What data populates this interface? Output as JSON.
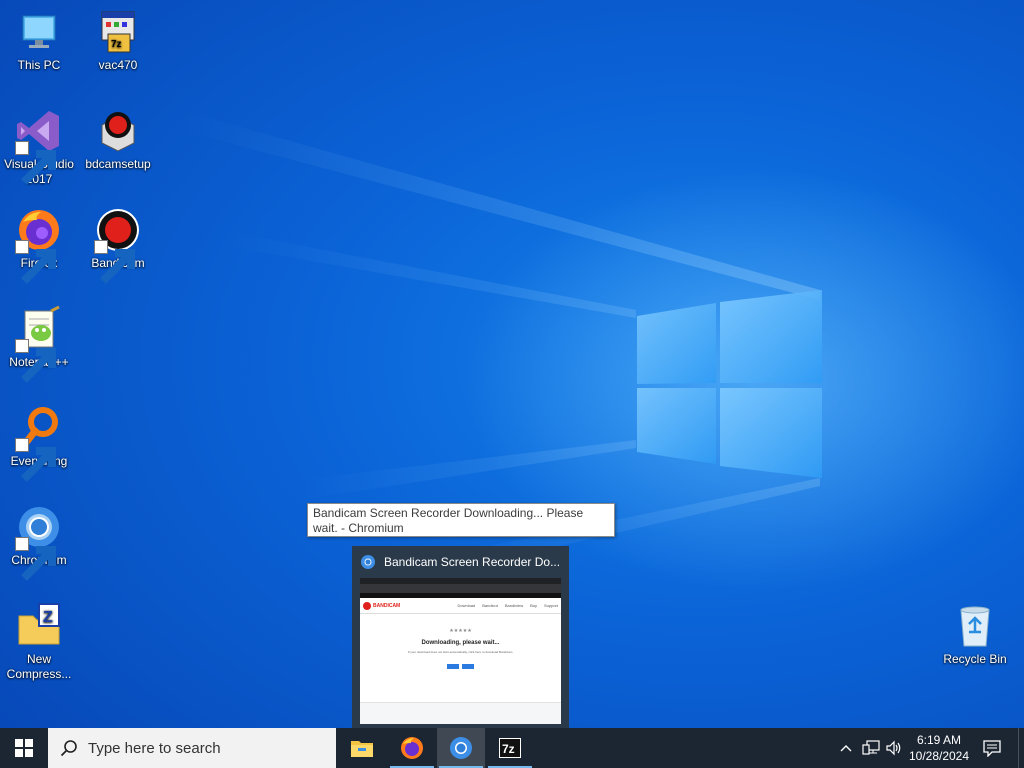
{
  "desktop": {
    "icons": [
      {
        "label": "This PC",
        "icon": "monitor-icon"
      },
      {
        "label": "vac470",
        "icon": "installer-icon"
      },
      {
        "label": "Visual Studio 2017",
        "icon": "visual-studio-icon"
      },
      {
        "label": "bdcamsetup",
        "icon": "bandicam-setup-icon"
      },
      {
        "label": "Firefox",
        "icon": "firefox-icon"
      },
      {
        "label": "Bandicam",
        "icon": "bandicam-icon"
      },
      {
        "label": "Notepad++",
        "icon": "notepadpp-icon"
      },
      {
        "label": "Everything",
        "icon": "everything-icon"
      },
      {
        "label": "Chromium",
        "icon": "chromium-icon"
      },
      {
        "label": "New Compress...",
        "icon": "zip-folder-icon"
      },
      {
        "label": "Recycle Bin",
        "icon": "recycle-bin-icon"
      }
    ]
  },
  "tooltip": {
    "text": "Bandicam Screen Recorder Downloading... Please wait. - Chromium"
  },
  "thumbnail": {
    "title": "Bandicam Screen Recorder Do...",
    "preview": {
      "brand": "BANDICAM",
      "nav": [
        "Download",
        "Bandicut",
        "Bandiview",
        "Buy",
        "Support"
      ],
      "heading": "Downloading, please wait...",
      "line": "If your download does not start automatically, click here to download Bandicam."
    }
  },
  "taskbar": {
    "search_placeholder": "Type here to search",
    "apps": [
      "file-explorer-icon",
      "firefox-icon",
      "chromium-icon",
      "7zip-icon"
    ],
    "clock_time": "6:19 AM",
    "clock_date": "10/28/2024"
  },
  "colors": {
    "taskbar": "#1c2633",
    "desktop_blue": "#0b63d6",
    "active_indicator": "#76b9ed"
  }
}
